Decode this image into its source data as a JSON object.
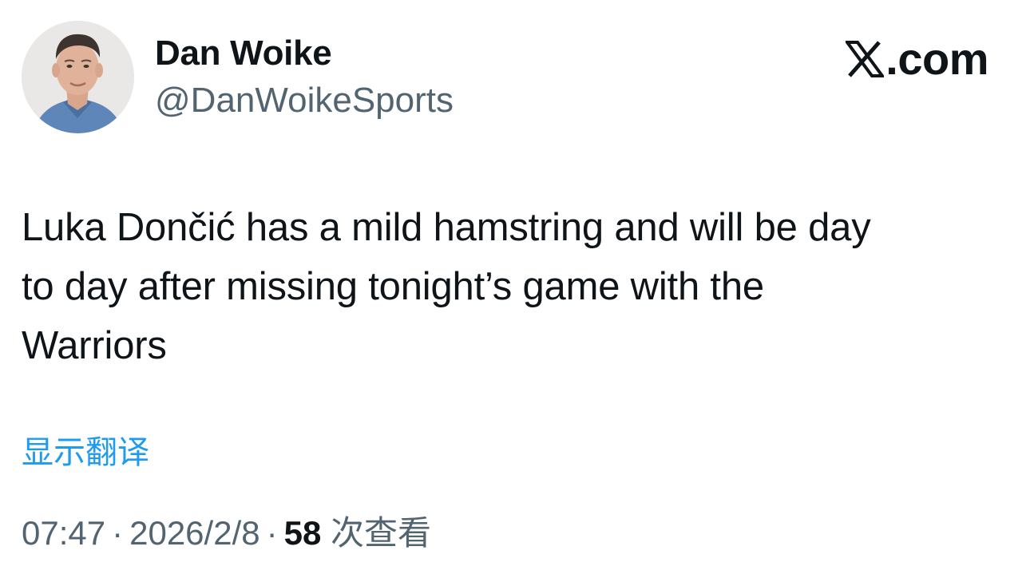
{
  "author": {
    "display_name": "Dan Woike",
    "handle": "@DanWoikeSports"
  },
  "brand": {
    "domain": ".com",
    "logo_icon": "x-logo-icon"
  },
  "tweet": {
    "text": "Luka Dončić has a mild hamstring and will be day\nto day after missing tonight’s game with the\nWarriors",
    "translate_label": "显示翻译"
  },
  "meta": {
    "time": "07:47",
    "separator": "·",
    "date": "2026/2/8",
    "views_count": "58",
    "views_label": "次查看"
  },
  "colors": {
    "text": "#0f1419",
    "secondary": "#536471",
    "link": "#1d9bf0",
    "background": "#ffffff"
  }
}
